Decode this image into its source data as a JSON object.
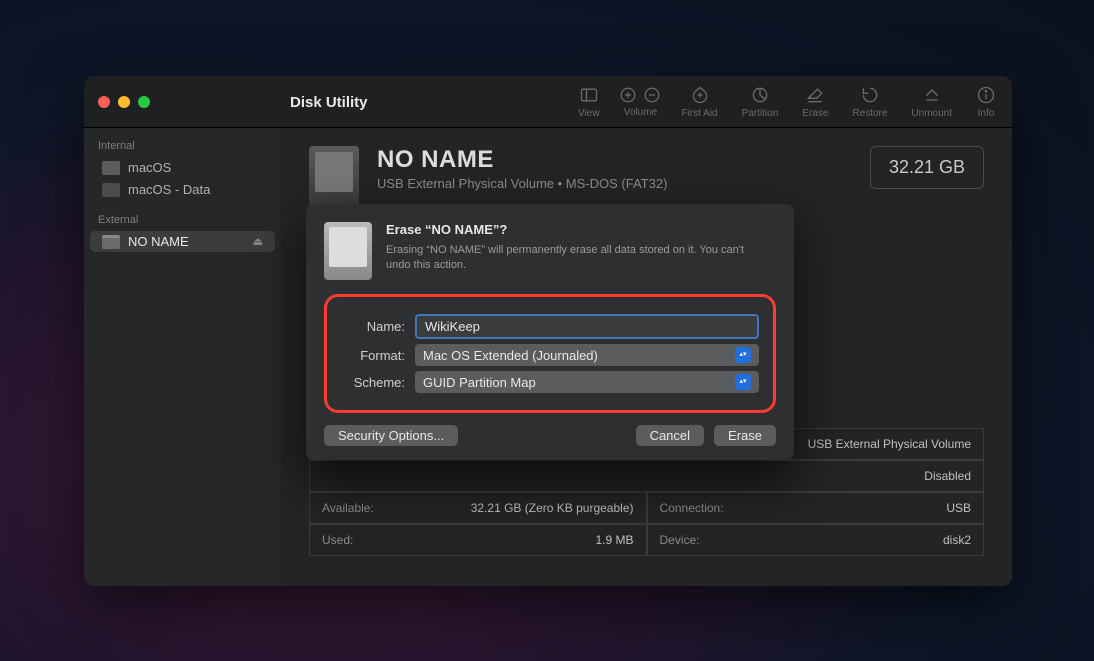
{
  "app": {
    "title": "Disk Utility"
  },
  "toolbar": {
    "view": "View",
    "volume": "Volume",
    "first_aid": "First Aid",
    "partition": "Partition",
    "erase": "Erase",
    "restore": "Restore",
    "unmount": "Unmount",
    "info": "Info"
  },
  "sidebar": {
    "internal_label": "Internal",
    "external_label": "External",
    "items": [
      {
        "label": "macOS"
      },
      {
        "label": "macOS - Data"
      },
      {
        "label": "NO NAME"
      }
    ]
  },
  "volume": {
    "name": "NO NAME",
    "subtitle": "USB External Physical Volume • MS-DOS (FAT32)",
    "capacity": "32.21 GB"
  },
  "info": {
    "available_label": "Available:",
    "available_value": "32.21 GB (Zero KB purgeable)",
    "used_label": "Used:",
    "used_value": "1.9 MB",
    "type_value": "USB External Physical Volume",
    "smart_label": "",
    "smart_value": "Disabled",
    "connection_label": "Connection:",
    "connection_value": "USB",
    "device_label": "Device:",
    "device_value": "disk2"
  },
  "dialog": {
    "title": "Erase “NO NAME”?",
    "description": "Erasing “NO NAME” will permanently erase all data stored on it. You can't undo this action.",
    "name_label": "Name:",
    "name_value": "WikiKeep",
    "format_label": "Format:",
    "format_value": "Mac OS Extended (Journaled)",
    "scheme_label": "Scheme:",
    "scheme_value": "GUID Partition Map",
    "security_options": "Security Options...",
    "cancel": "Cancel",
    "erase": "Erase"
  }
}
